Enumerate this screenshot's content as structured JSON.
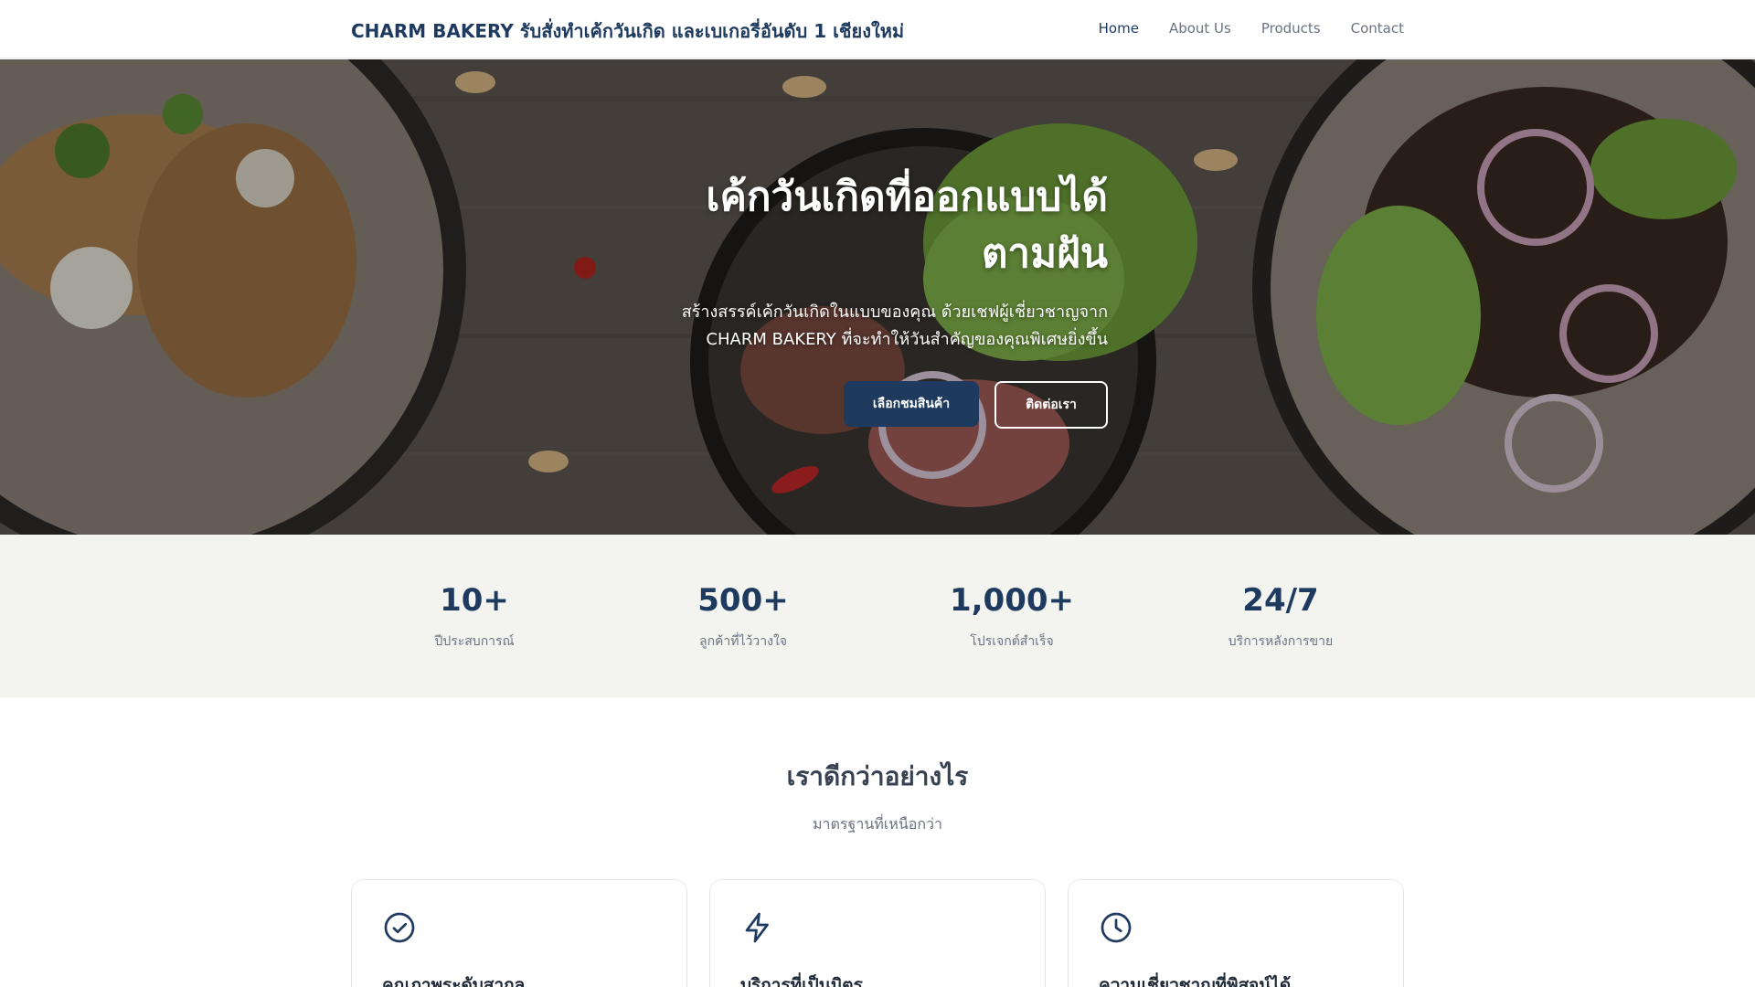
{
  "navbar": {
    "brand": "CHARM BAKERY รับสั่งทำเค้กวันเกิด และเบเกอรี่อันดับ 1 เชียงใหม่",
    "links": [
      {
        "label": "Home",
        "active": true
      },
      {
        "label": "About Us",
        "active": false
      },
      {
        "label": "Products",
        "active": false
      },
      {
        "label": "Contact",
        "active": false
      }
    ]
  },
  "hero": {
    "title_line1": "เค้กวันเกิดที่ออกแบบได้",
    "title_line2": "ตามฝัน",
    "subtitle_line1": "สร้างสรรค์เค้กวันเกิดในแบบของคุณ ด้วยเชฟผู้เชี่ยวชาญจาก",
    "subtitle_line2": "CHARM BAKERY ที่จะทำให้วันสำคัญของคุณพิเศษยิ่งขึ้น",
    "primary_button": "เลือกชมสินค้า",
    "secondary_button": "ติดต่อเรา"
  },
  "stats": [
    {
      "value": "10+",
      "label": "ปีประสบการณ์"
    },
    {
      "value": "500+",
      "label": "ลูกค้าที่ไว้วางใจ"
    },
    {
      "value": "1,000+",
      "label": "โปรเจกต์สำเร็จ"
    },
    {
      "value": "24/7",
      "label": "บริการหลังการขาย"
    }
  ],
  "features": {
    "title": "เราดีกว่าอย่างไร",
    "subtitle": "มาตรฐานที่เหนือกว่า",
    "cards": [
      {
        "icon": "check-circle-icon",
        "title": "คุณภาพระดับสากล"
      },
      {
        "icon": "lightning-icon",
        "title": "บริการที่เป็นมิตร"
      },
      {
        "icon": "clock-icon",
        "title": "ความเชี่ยวชาญที่พิสูจน์ได้"
      }
    ]
  },
  "colors": {
    "brand_navy": "#1e3a5f",
    "stats_background": "#f3f4ef",
    "muted_text": "#6b7280"
  }
}
